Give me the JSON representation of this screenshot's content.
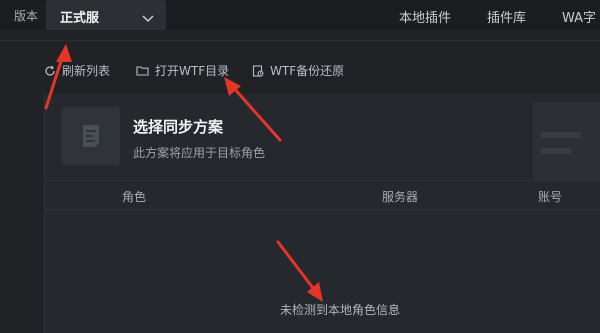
{
  "topbar": {
    "version_label": "版本",
    "version_value": "正式服",
    "tabs": [
      {
        "label": "本地插件"
      },
      {
        "label": "插件库"
      },
      {
        "label": "WA字"
      }
    ]
  },
  "actions": {
    "refresh": "刷新列表",
    "open_wtf": "打开WTF目录",
    "backup": "WTF备份还原"
  },
  "scheme": {
    "title": "选择同步方案",
    "subtitle": "此方案将应用于目标角色"
  },
  "table": {
    "columns": [
      "角色",
      "服务器",
      "账号"
    ],
    "empty": "未检测到本地角色信息"
  },
  "colors": {
    "background": "#202226",
    "panel": "#25282d",
    "annotation_arrow": "#e5352b"
  }
}
